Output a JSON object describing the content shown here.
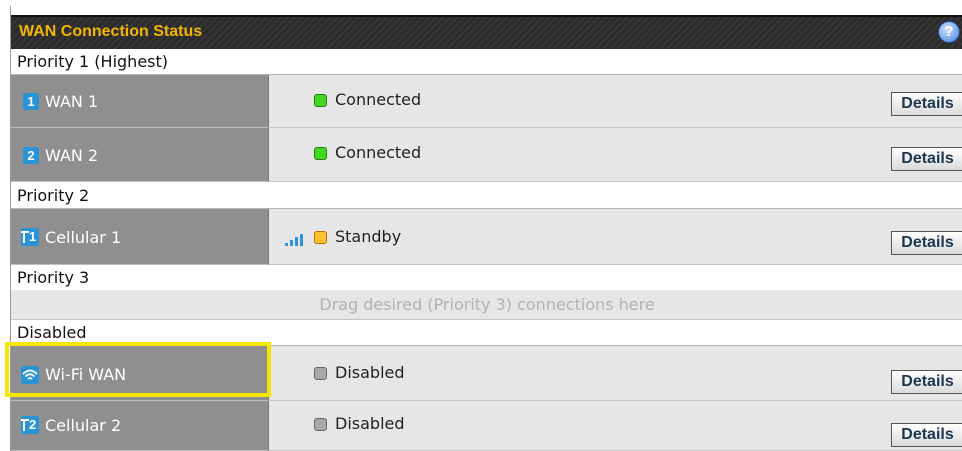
{
  "header": {
    "title": "WAN Connection Status",
    "help_glyph": "?"
  },
  "groups": {
    "priority1": "Priority 1 (Highest)",
    "priority2": "Priority 2",
    "priority3": "Priority 3",
    "disabled": "Disabled"
  },
  "connections": [
    {
      "icon_label": "1",
      "icon": "wan-number-icon",
      "name": "WAN 1",
      "status": "Connected",
      "led": "#40d820",
      "details": "Details"
    },
    {
      "icon_label": "2",
      "icon": "wan-number-icon",
      "name": "WAN 2",
      "status": "Connected",
      "led": "#40d820",
      "details": "Details"
    },
    {
      "icon_label": "1",
      "icon": "cellular-icon",
      "name": "Cellular 1",
      "status": "Standby",
      "led": "#ffc130",
      "signal": "signal-bars-icon",
      "details": "Details"
    },
    {
      "icon": "wifi-icon",
      "name": "Wi-Fi WAN",
      "status": "Disabled",
      "led": "#a8a8a8",
      "details": "Details"
    },
    {
      "icon_label": "2",
      "icon": "cellular-icon",
      "name": "Cellular 2",
      "status": "Disabled",
      "led": "#a8a8a8",
      "details": "Details"
    }
  ],
  "priority3_drop_zone": "Drag desired (Priority 3) connections here",
  "colors": {
    "accent_title": "#f5b400",
    "icon_blue": "#2a92d6",
    "highlight": "#f6e600"
  }
}
